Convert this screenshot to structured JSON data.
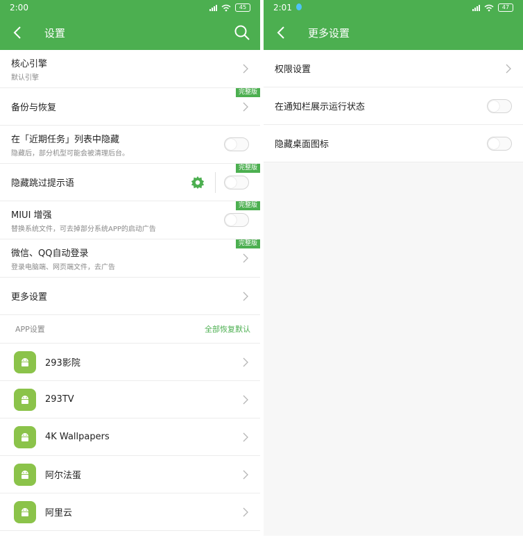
{
  "left": {
    "status": {
      "time": "2:00",
      "battery": "45"
    },
    "title": "设置",
    "items": [
      {
        "title": "核心引擎",
        "sub": "默认引擎"
      },
      {
        "title": "备份与恢复",
        "badge": "完整版"
      },
      {
        "title": "在「近期任务」列表中隐藏",
        "sub": "隐藏后，部分机型可能会被清理后台。"
      },
      {
        "title": "隐藏跳过提示语",
        "badge": "完整版"
      },
      {
        "title": "MIUI 增强",
        "sub": "替换系统文件，可去掉部分系统APP的启动广告",
        "badge": "完整版"
      },
      {
        "title": "微信、QQ自动登录",
        "sub": "登录电脑端、网页端文件，去广告",
        "badge": "完整版"
      },
      {
        "title": "更多设置"
      }
    ],
    "section": {
      "label": "APP设置",
      "action": "全部恢复默认"
    },
    "apps": [
      "293影院",
      "293TV",
      "4K Wallpapers",
      "阿尔法蛋",
      "阿里云"
    ]
  },
  "right": {
    "status": {
      "time": "2:01",
      "battery": "47"
    },
    "title": "更多设置",
    "items": [
      {
        "title": "权限设置"
      },
      {
        "title": "在通知栏展示运行状态"
      },
      {
        "title": "隐藏桌面图标"
      }
    ]
  },
  "colors": {
    "accent": "#4caf50",
    "app_icon": "#8bc34a"
  }
}
